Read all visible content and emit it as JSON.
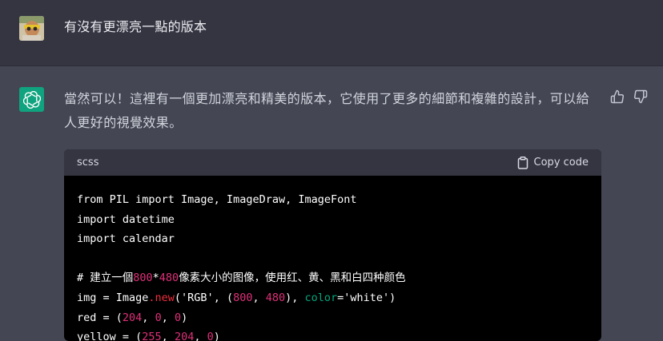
{
  "user_message": {
    "text": "有沒有更漂亮一點的版本"
  },
  "assistant_message": {
    "text": "當然可以！這裡有一個更加漂亮和精美的版本，它使用了更多的細節和複雜的設計，可以給人更好的視覺效果。",
    "feedback": {
      "thumbs_up": "thumbs-up",
      "thumbs_down": "thumbs-down"
    }
  },
  "code_block": {
    "language": "scss",
    "copy_label": "Copy code",
    "lines": [
      [
        {
          "t": "from PIL import Image, ImageDraw, ImageFont",
          "c": ""
        }
      ],
      [
        {
          "t": "import datetime",
          "c": ""
        }
      ],
      [
        {
          "t": "import calendar",
          "c": ""
        }
      ],
      [
        {
          "t": "",
          "c": ""
        }
      ],
      [
        {
          "t": "# 建立一個",
          "c": ""
        },
        {
          "t": "800",
          "c": "num"
        },
        {
          "t": "*",
          "c": ""
        },
        {
          "t": "480",
          "c": "num"
        },
        {
          "t": "像素大小的图像，使用红、黄、黑和白四种颜色",
          "c": ""
        }
      ],
      [
        {
          "t": "img = Image",
          "c": ""
        },
        {
          "t": ".new",
          "c": "fn"
        },
        {
          "t": "('RGB', (",
          "c": ""
        },
        {
          "t": "800",
          "c": "num"
        },
        {
          "t": ", ",
          "c": ""
        },
        {
          "t": "480",
          "c": "num"
        },
        {
          "t": "), ",
          "c": ""
        },
        {
          "t": "color",
          "c": "attr"
        },
        {
          "t": "='white')",
          "c": ""
        }
      ],
      [
        {
          "t": "red = (",
          "c": ""
        },
        {
          "t": "204",
          "c": "num"
        },
        {
          "t": ", ",
          "c": ""
        },
        {
          "t": "0",
          "c": "num"
        },
        {
          "t": ", ",
          "c": ""
        },
        {
          "t": "0",
          "c": "num"
        },
        {
          "t": ")",
          "c": ""
        }
      ],
      [
        {
          "t": "yellow = (",
          "c": ""
        },
        {
          "t": "255",
          "c": "num"
        },
        {
          "t": ", ",
          "c": ""
        },
        {
          "t": "204",
          "c": "num"
        },
        {
          "t": ", ",
          "c": ""
        },
        {
          "t": "0",
          "c": "num"
        },
        {
          "t": ")",
          "c": ""
        }
      ]
    ]
  },
  "colors": {
    "page_bg": "#444654",
    "user_row_bg": "#343541",
    "gpt_brand": "#10a37f",
    "code_bg": "#000000",
    "code_number": "#df3079",
    "code_function": "#f22c3d",
    "code_attr": "#00a67d"
  }
}
